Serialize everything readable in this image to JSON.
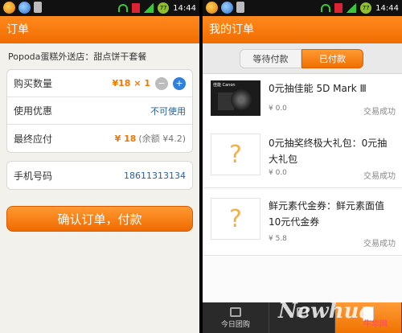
{
  "status_bar": {
    "left": {
      "time": "14:44"
    },
    "right": {
      "time": "14:44"
    }
  },
  "order_screen": {
    "title": "订单",
    "shop_name": "Popoda蛋糕外送店：甜点饼干套餐",
    "quantity": {
      "label": "购买数量",
      "value": "¥18 × 1"
    },
    "coupon": {
      "label": "使用优惠",
      "value": "不可使用"
    },
    "total": {
      "label": "最终应付",
      "value": "¥ 18",
      "balance": "(余额 ¥4.2)"
    },
    "phone": {
      "label": "手机号码",
      "value": "18611313134"
    },
    "confirm_button": "确认订单，付款"
  },
  "my_orders_screen": {
    "title": "我的订单",
    "tabs": [
      {
        "label": "等待付款",
        "active": false
      },
      {
        "label": "已付款",
        "active": true
      }
    ],
    "orders": [
      {
        "title": "0元抽佳能 5D Mark Ⅲ",
        "price": "¥ 0.0",
        "status": "交易成功",
        "thumb": "camera-image",
        "thumb_text": "佳能 Canon"
      },
      {
        "title": "0元抽奖终极大礼包：0元抽大礼包",
        "price": "¥ 0.0",
        "status": "交易成功",
        "thumb": "placeholder-question-icon"
      },
      {
        "title": "鲜元素代金券：鲜元素面值10元代金券",
        "price": "¥ 5.8",
        "status": "交易成功",
        "thumb": "placeholder-question-icon"
      }
    ],
    "bottom_nav": [
      {
        "label": "今日团购",
        "icon": "bag-icon"
      },
      {
        "label": "",
        "icon": "camera-icon"
      },
      {
        "label": "",
        "icon": "document-icon"
      }
    ],
    "watermark": "Newhua",
    "watermark_cn": "牛华网"
  },
  "colors": {
    "accent": "#f07800",
    "header_orange": "#ff8a1f",
    "link_blue": "#2a5f9a",
    "status_bar": "#111111"
  }
}
